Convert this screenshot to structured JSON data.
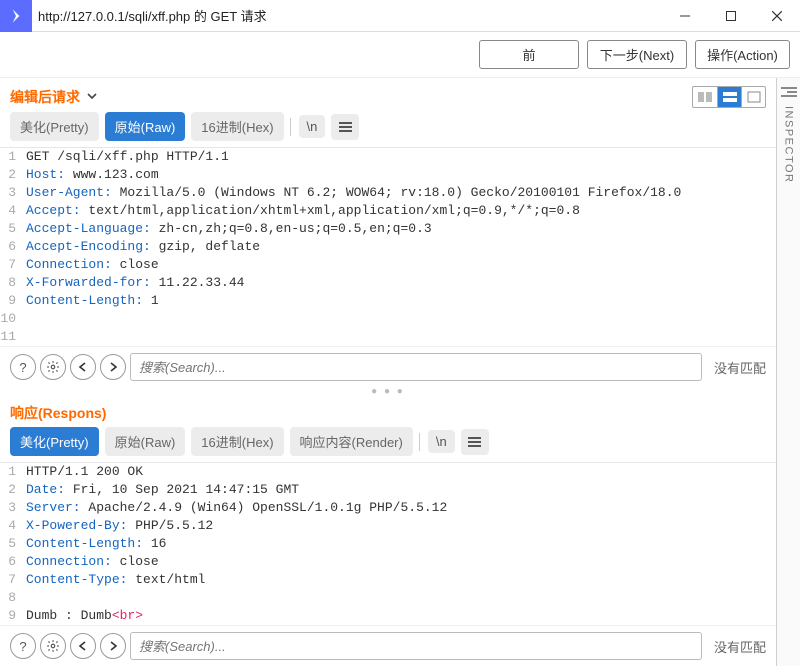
{
  "window": {
    "title": "http://127.0.0.1/sqli/xff.php 的 GET 请求"
  },
  "top_buttons": {
    "forward": "前",
    "next": "下一步(Next)",
    "action": "操作(Action)"
  },
  "inspector_label": "INSPECTOR",
  "request": {
    "title": "编辑后请求",
    "tabs": {
      "pretty": "美化(Pretty)",
      "raw": "原始(Raw)",
      "hex": "16进制(Hex)",
      "nl": "\\n"
    },
    "lines": [
      {
        "n": 1,
        "plain": "GET /sqli/xff.php HTTP/1.1"
      },
      {
        "n": 2,
        "key": "Host:",
        "val": " www.123.com"
      },
      {
        "n": 3,
        "key": "User-Agent:",
        "val": " Mozilla/5.0 (Windows NT 6.2; WOW64; rv:18.0) Gecko/20100101 Firefox/18.0"
      },
      {
        "n": 4,
        "key": "Accept:",
        "val": " text/html,application/xhtml+xml,application/xml;q=0.9,*/*;q=0.8"
      },
      {
        "n": 5,
        "key": "Accept-Language:",
        "val": " zh-cn,zh;q=0.8,en-us;q=0.5,en;q=0.3"
      },
      {
        "n": 6,
        "key": "Accept-Encoding:",
        "val": " gzip, deflate"
      },
      {
        "n": 7,
        "key": "Connection:",
        "val": " close"
      },
      {
        "n": 8,
        "key": "X-Forwarded-for:",
        "val": " 11.22.33.44"
      },
      {
        "n": 9,
        "key": "Content-Length:",
        "val": " 1"
      },
      {
        "n": 10,
        "plain": ""
      },
      {
        "n": 11,
        "plain": ""
      }
    ],
    "search_placeholder": "搜索(Search)...",
    "nomatch": "没有匹配"
  },
  "response": {
    "title": "响应(Respons)",
    "tabs": {
      "pretty": "美化(Pretty)",
      "raw": "原始(Raw)",
      "hex": "16进制(Hex)",
      "render": "响应内容(Render)",
      "nl": "\\n"
    },
    "lines": [
      {
        "n": 1,
        "plain": "HTTP/1.1 200 OK"
      },
      {
        "n": 2,
        "key": "Date:",
        "val": " Fri, 10 Sep 2021 14:47:15 GMT"
      },
      {
        "n": 3,
        "key": "Server:",
        "val": " Apache/2.4.9 (Win64) OpenSSL/1.0.1g PHP/5.5.12"
      },
      {
        "n": 4,
        "key": "X-Powered-By:",
        "val": " PHP/5.5.12"
      },
      {
        "n": 5,
        "key": "Content-Length:",
        "val": " 16"
      },
      {
        "n": 6,
        "key": "Connection:",
        "val": " close"
      },
      {
        "n": 7,
        "key": "Content-Type:",
        "val": " text/html"
      },
      {
        "n": 8,
        "plain": ""
      },
      {
        "n": 9,
        "body_pre": "Dumb : Dumb",
        "tag": "<br>"
      }
    ],
    "search_placeholder": "搜索(Search)...",
    "nomatch": "没有匹配"
  }
}
